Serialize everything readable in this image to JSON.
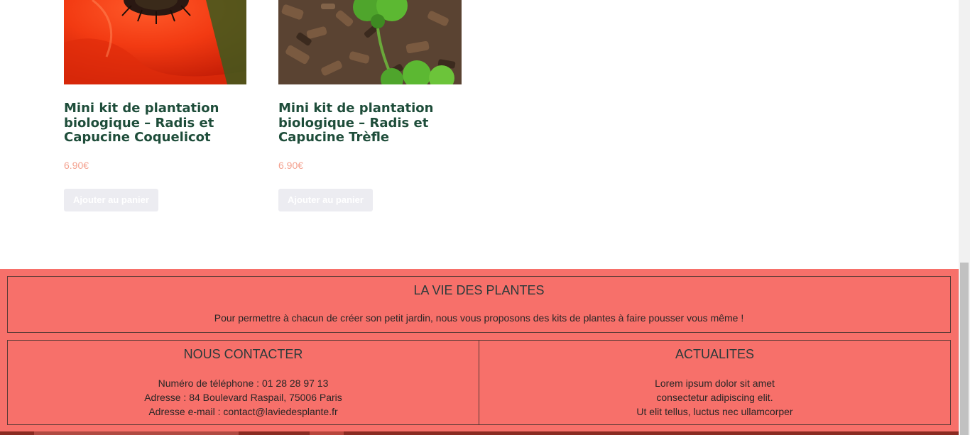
{
  "products": [
    {
      "title": "Mini kit de plantation biologique – Radis et Capucine Coquelicot",
      "price": "6.90€",
      "button_label": "Ajouter au panier",
      "image_icon": "poppy-flower-image"
    },
    {
      "title": "Mini kit de plantation biologique – Radis et Capucine Trèfle",
      "price": "6.90€",
      "button_label": "Ajouter au panier",
      "image_icon": "clover-image"
    }
  ],
  "footer": {
    "about": {
      "heading": "LA VIE DES PLANTES",
      "text": "Pour permettre à chacun de créer son petit jardin, nous vous proposons des kits de plantes à faire pousser vous même !"
    },
    "contact": {
      "heading": "NOUS CONTACTER",
      "phone": "Numéro de téléphone : 01 28 28 97 13",
      "address": "Adresse : 84 Boulevard Raspail, 75006 Paris",
      "email": "Adresse e-mail : contact@laviedesplante.fr"
    },
    "news": {
      "heading": "ACTUALITES",
      "line1": "Lorem ipsum dolor sit amet",
      "line2": "consectetur adipiscing elit.",
      "line3": "Ut elit tellus, luctus nec ullamcorper"
    }
  },
  "colors": {
    "footer_bg": "#f7706a",
    "title_green": "#1e4d3a",
    "price": "#f4a18f",
    "button_bg": "#ececf1"
  }
}
